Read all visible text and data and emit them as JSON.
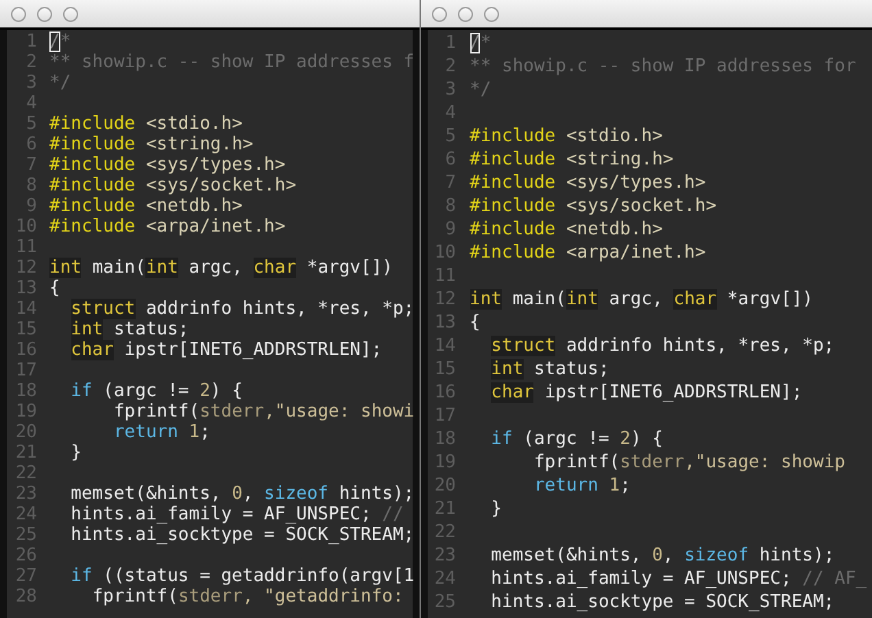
{
  "windows": [
    {
      "lines": [
        {
          "number": "1",
          "tokens": [
            {
              "kind": "cursor",
              "text": "/"
            },
            {
              "kind": "comment",
              "text": "*"
            }
          ]
        },
        {
          "number": "2",
          "tokens": [
            {
              "kind": "comment",
              "text": "** showip.c -- show IP addresses f"
            }
          ]
        },
        {
          "number": "3",
          "tokens": [
            {
              "kind": "comment",
              "text": "*/"
            }
          ]
        },
        {
          "number": "4"
        },
        {
          "number": "5",
          "tokens": [
            {
              "kind": "preproc",
              "text": "#include"
            },
            {
              "kind": "header",
              "text": " <stdio.h>"
            }
          ]
        },
        {
          "number": "6",
          "tokens": [
            {
              "kind": "preproc",
              "text": "#include"
            },
            {
              "kind": "header",
              "text": " <string.h>"
            }
          ]
        },
        {
          "number": "7",
          "tokens": [
            {
              "kind": "preproc",
              "text": "#include"
            },
            {
              "kind": "header",
              "text": " <sys/types.h>"
            }
          ]
        },
        {
          "number": "8",
          "tokens": [
            {
              "kind": "preproc",
              "text": "#include"
            },
            {
              "kind": "header",
              "text": " <sys/socket.h>"
            }
          ]
        },
        {
          "number": "9",
          "tokens": [
            {
              "kind": "preproc",
              "text": "#include"
            },
            {
              "kind": "header",
              "text": " <netdb.h>"
            }
          ]
        },
        {
          "number": "10",
          "tokens": [
            {
              "kind": "preproc",
              "text": "#include"
            },
            {
              "kind": "header",
              "text": " <arpa/inet.h>"
            }
          ]
        },
        {
          "number": "11"
        },
        {
          "number": "12",
          "tokens": [
            {
              "kind": "type",
              "text": "int"
            },
            {
              "kind": "plain",
              "text": " main("
            },
            {
              "kind": "type",
              "text": "int"
            },
            {
              "kind": "plain",
              "text": " argc, "
            },
            {
              "kind": "type",
              "text": "char"
            },
            {
              "kind": "plain",
              "text": " *argv[])"
            }
          ]
        },
        {
          "number": "13",
          "tokens": [
            {
              "kind": "plain",
              "text": "{"
            }
          ]
        },
        {
          "number": "14",
          "tokens": [
            {
              "kind": "type",
              "text": "  struct"
            },
            {
              "kind": "plain",
              "text": " addrinfo hints, *res, *p;"
            }
          ]
        },
        {
          "number": "15",
          "tokens": [
            {
              "kind": "type",
              "text": "  int"
            },
            {
              "kind": "plain",
              "text": " status;"
            }
          ]
        },
        {
          "number": "16",
          "tokens": [
            {
              "kind": "type",
              "text": "  char"
            },
            {
              "kind": "plain",
              "text": " ipstr[INET6_ADDRSTRLEN];"
            }
          ]
        },
        {
          "number": "17"
        },
        {
          "number": "18",
          "tokens": [
            {
              "kind": "keyword",
              "text": "  if"
            },
            {
              "kind": "plain",
              "text": " (argc != "
            },
            {
              "kind": "number",
              "text": "2"
            },
            {
              "kind": "plain",
              "text": ") {"
            }
          ]
        },
        {
          "number": "19",
          "tokens": [
            {
              "kind": "plain",
              "text": "      fprintf("
            },
            {
              "kind": "builtin",
              "text": "stderr"
            },
            {
              "kind": "string",
              "text": ",\"usage: showi"
            }
          ]
        },
        {
          "number": "20",
          "tokens": [
            {
              "kind": "keyword",
              "text": "      return"
            },
            {
              "kind": "number",
              "text": " 1"
            },
            {
              "kind": "plain",
              "text": ";"
            }
          ]
        },
        {
          "number": "21",
          "tokens": [
            {
              "kind": "plain",
              "text": "  }"
            }
          ]
        },
        {
          "number": "22"
        },
        {
          "number": "23",
          "tokens": [
            {
              "kind": "plain",
              "text": "  memset(&hints, "
            },
            {
              "kind": "number",
              "text": "0"
            },
            {
              "kind": "plain",
              "text": ", "
            },
            {
              "kind": "keyword",
              "text": "sizeof"
            },
            {
              "kind": "plain",
              "text": " hints);"
            }
          ]
        },
        {
          "number": "24",
          "tokens": [
            {
              "kind": "plain",
              "text": "  hints.ai_family = AF_UNSPEC; "
            },
            {
              "kind": "comment",
              "text": "//"
            }
          ]
        },
        {
          "number": "25",
          "tokens": [
            {
              "kind": "plain",
              "text": "  hints.ai_socktype = SOCK_STREAM;"
            }
          ]
        },
        {
          "number": "26"
        },
        {
          "number": "27",
          "tokens": [
            {
              "kind": "keyword",
              "text": "  if"
            },
            {
              "kind": "plain",
              "text": " ((status = getaddrinfo(argv[1"
            }
          ]
        },
        {
          "number": "28",
          "tokens": [
            {
              "kind": "plain",
              "text": "    fprintf("
            },
            {
              "kind": "builtin",
              "text": "stderr"
            },
            {
              "kind": "string",
              "text": ", \"getaddrinfo:"
            }
          ]
        }
      ]
    },
    {
      "lines": [
        {
          "number": "1",
          "tokens": [
            {
              "kind": "cursor",
              "text": "/"
            },
            {
              "kind": "comment",
              "text": "*"
            }
          ]
        },
        {
          "number": "2",
          "tokens": [
            {
              "kind": "comment",
              "text": "** showip.c -- show IP addresses for"
            }
          ]
        },
        {
          "number": "3",
          "tokens": [
            {
              "kind": "comment",
              "text": "*/"
            }
          ]
        },
        {
          "number": "4"
        },
        {
          "number": "5",
          "tokens": [
            {
              "kind": "preproc",
              "text": "#include"
            },
            {
              "kind": "header",
              "text": " <stdio.h>"
            }
          ]
        },
        {
          "number": "6",
          "tokens": [
            {
              "kind": "preproc",
              "text": "#include"
            },
            {
              "kind": "header",
              "text": " <string.h>"
            }
          ]
        },
        {
          "number": "7",
          "tokens": [
            {
              "kind": "preproc",
              "text": "#include"
            },
            {
              "kind": "header",
              "text": " <sys/types.h>"
            }
          ]
        },
        {
          "number": "8",
          "tokens": [
            {
              "kind": "preproc",
              "text": "#include"
            },
            {
              "kind": "header",
              "text": " <sys/socket.h>"
            }
          ]
        },
        {
          "number": "9",
          "tokens": [
            {
              "kind": "preproc",
              "text": "#include"
            },
            {
              "kind": "header",
              "text": " <netdb.h>"
            }
          ]
        },
        {
          "number": "10",
          "tokens": [
            {
              "kind": "preproc",
              "text": "#include"
            },
            {
              "kind": "header",
              "text": " <arpa/inet.h>"
            }
          ]
        },
        {
          "number": "11"
        },
        {
          "number": "12",
          "tokens": [
            {
              "kind": "type",
              "text": "int"
            },
            {
              "kind": "plain",
              "text": " main("
            },
            {
              "kind": "type",
              "text": "int"
            },
            {
              "kind": "plain",
              "text": " argc, "
            },
            {
              "kind": "type",
              "text": "char"
            },
            {
              "kind": "plain",
              "text": " *argv[])"
            }
          ]
        },
        {
          "number": "13",
          "tokens": [
            {
              "kind": "plain",
              "text": "{"
            }
          ]
        },
        {
          "number": "14",
          "tokens": [
            {
              "kind": "type",
              "text": "  struct"
            },
            {
              "kind": "plain",
              "text": " addrinfo hints, *res, *p;"
            }
          ]
        },
        {
          "number": "15",
          "tokens": [
            {
              "kind": "type",
              "text": "  int"
            },
            {
              "kind": "plain",
              "text": " status;"
            }
          ]
        },
        {
          "number": "16",
          "tokens": [
            {
              "kind": "type",
              "text": "  char"
            },
            {
              "kind": "plain",
              "text": " ipstr[INET6_ADDRSTRLEN];"
            }
          ]
        },
        {
          "number": "17"
        },
        {
          "number": "18",
          "tokens": [
            {
              "kind": "keyword",
              "text": "  if"
            },
            {
              "kind": "plain",
              "text": " (argc != "
            },
            {
              "kind": "number",
              "text": "2"
            },
            {
              "kind": "plain",
              "text": ") {"
            }
          ]
        },
        {
          "number": "19",
          "tokens": [
            {
              "kind": "plain",
              "text": "      fprintf("
            },
            {
              "kind": "builtin",
              "text": "stderr"
            },
            {
              "kind": "string",
              "text": ",\"usage: showip"
            }
          ]
        },
        {
          "number": "20",
          "tokens": [
            {
              "kind": "keyword",
              "text": "      return"
            },
            {
              "kind": "number",
              "text": " 1"
            },
            {
              "kind": "plain",
              "text": ";"
            }
          ]
        },
        {
          "number": "21",
          "tokens": [
            {
              "kind": "plain",
              "text": "  }"
            }
          ]
        },
        {
          "number": "22"
        },
        {
          "number": "23",
          "tokens": [
            {
              "kind": "plain",
              "text": "  memset(&hints, "
            },
            {
              "kind": "number",
              "text": "0"
            },
            {
              "kind": "plain",
              "text": ", "
            },
            {
              "kind": "keyword",
              "text": "sizeof"
            },
            {
              "kind": "plain",
              "text": " hints);"
            }
          ]
        },
        {
          "number": "24",
          "tokens": [
            {
              "kind": "plain",
              "text": "  hints.ai_family = AF_UNSPEC; "
            },
            {
              "kind": "comment",
              "text": "// AF_"
            }
          ]
        },
        {
          "number": "25",
          "tokens": [
            {
              "kind": "plain",
              "text": "  hints.ai_socktype = SOCK_STREAM;"
            }
          ]
        }
      ]
    }
  ]
}
